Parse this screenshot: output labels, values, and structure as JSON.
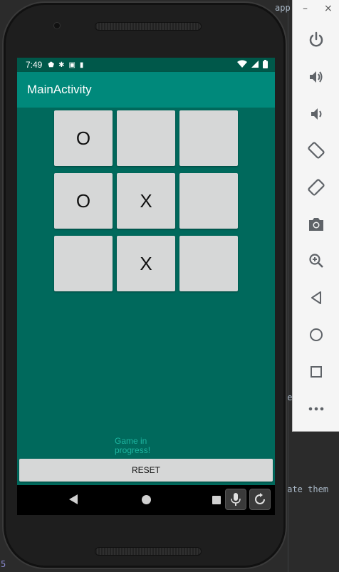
{
  "ide": {
    "top_text": "app",
    "right_text_1": "re",
    "right_text_2": "late them",
    "bottom_left": "5"
  },
  "phone_status": {
    "time": "7:49"
  },
  "app": {
    "title": "MainActivity"
  },
  "board": {
    "cells": [
      "O",
      "",
      "",
      "O",
      "X",
      "",
      "",
      "X",
      ""
    ]
  },
  "game_status": "Game in progress!",
  "reset_label": "RESET",
  "emulator_toolbar": {
    "minimize_label": "–",
    "close_label": "×",
    "buttons": [
      "power-icon",
      "volume-up-icon",
      "volume-down-icon",
      "rotate-left-icon",
      "rotate-right-icon",
      "camera-icon",
      "zoom-icon",
      "back-icon",
      "home-icon",
      "overview-icon",
      "more-icon"
    ]
  },
  "colors": {
    "status_bar": "#00584a",
    "app_bar": "#00897b",
    "content_bg": "#00695c",
    "cell_bg": "#d6d7d7",
    "status_text": "#1db5a0",
    "toolbar_icon": "#5f6368"
  }
}
